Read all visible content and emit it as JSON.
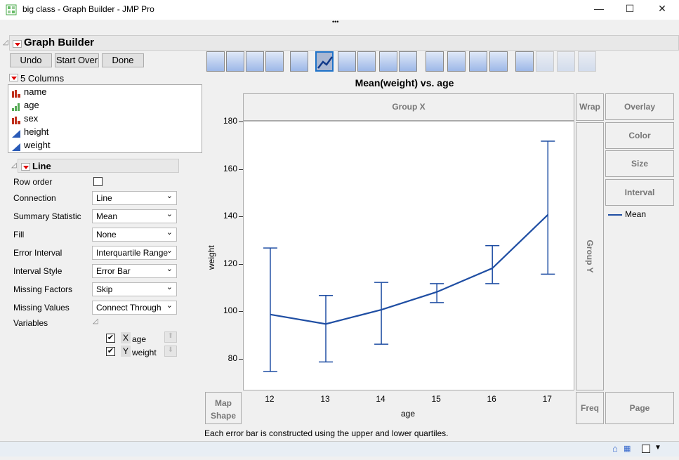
{
  "window": {
    "title": "big class - Graph Builder - JMP Pro",
    "minimize": "—",
    "maximize": "☐",
    "close": "✕",
    "more": "•••"
  },
  "panel": {
    "title": "Graph Builder",
    "undo": "Undo",
    "start_over": "Start Over",
    "done": "Done"
  },
  "columns": {
    "header": "5 Columns",
    "items": [
      {
        "name": "name",
        "type": "nominal"
      },
      {
        "name": "age",
        "type": "ordinal"
      },
      {
        "name": "sex",
        "type": "nominal"
      },
      {
        "name": "height",
        "type": "continuous"
      },
      {
        "name": "weight",
        "type": "continuous"
      }
    ]
  },
  "line_panel": {
    "title": "Line",
    "row_order": "Row order",
    "options": [
      {
        "label": "Connection",
        "value": "Line"
      },
      {
        "label": "Summary Statistic",
        "value": "Mean"
      },
      {
        "label": "Fill",
        "value": "None"
      },
      {
        "label": "Error Interval",
        "value": "Interquartile Range"
      },
      {
        "label": "Interval Style",
        "value": "Error Bar"
      },
      {
        "label": "Missing Factors",
        "value": "Skip"
      },
      {
        "label": "Missing Values",
        "value": "Connect Through"
      }
    ],
    "variables": "Variables",
    "vars": [
      {
        "role": "X",
        "name": "age"
      },
      {
        "role": "Y",
        "name": "weight"
      }
    ]
  },
  "zones": {
    "group_x": "Group X",
    "wrap": "Wrap",
    "overlay": "Overlay",
    "color": "Color",
    "size": "Size",
    "interval": "Interval",
    "group_y": "Group Y",
    "map_shape": "Map Shape",
    "freq": "Freq",
    "page": "Page"
  },
  "legend": {
    "label": "Mean"
  },
  "footnote": "Each error bar is constructed using the upper and lower quartiles.",
  "colors": {
    "line": "#1f4ea3"
  },
  "chart_data": {
    "type": "line",
    "title": "Mean(weight) vs. age",
    "xlabel": "age",
    "ylabel": "weight",
    "x": [
      12,
      13,
      14,
      15,
      16,
      17
    ],
    "series": [
      {
        "name": "Mean",
        "values": [
          99,
          95,
          101,
          108.5,
          118.5,
          141
        ]
      }
    ],
    "error_low": [
      75,
      79,
      86.5,
      104,
      112,
      116
    ],
    "error_high": [
      127,
      107,
      112.5,
      112,
      128,
      172
    ],
    "xlim": [
      11.52,
      17.49
    ],
    "ylim": [
      66.7,
      180.3
    ],
    "yticks": [
      80,
      100,
      120,
      140,
      160,
      180
    ],
    "grid": false,
    "legend": "right"
  }
}
